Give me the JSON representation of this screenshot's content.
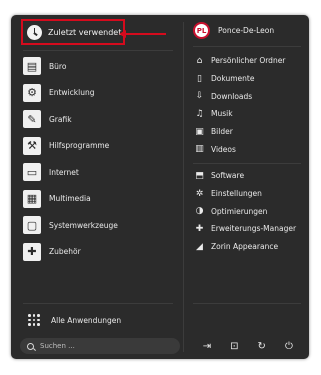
{
  "recent": {
    "label": "Zuletzt verwendet",
    "icon": "clock-icon"
  },
  "categories": [
    {
      "label": "Büro",
      "icon": "document-icon",
      "glyph": "▤"
    },
    {
      "label": "Entwicklung",
      "icon": "gear-icon",
      "glyph": "⚙"
    },
    {
      "label": "Grafik",
      "icon": "pencil-icon",
      "glyph": "✎"
    },
    {
      "label": "Hilfsprogramme",
      "icon": "wrench-icon",
      "glyph": "⚒"
    },
    {
      "label": "Internet",
      "icon": "globe-window-icon",
      "glyph": "▭"
    },
    {
      "label": "Multimedia",
      "icon": "film-icon",
      "glyph": "▦"
    },
    {
      "label": "Systemwerkzeuge",
      "icon": "monitor-icon",
      "glyph": "▢"
    },
    {
      "label": "Zubehör",
      "icon": "puzzle-icon",
      "glyph": "✚"
    }
  ],
  "all_apps": {
    "label": "Alle Anwendungen",
    "icon": "grid-icon"
  },
  "search": {
    "placeholder": "Suchen ...",
    "value": ""
  },
  "user": {
    "name": "Ponce-De-Leon",
    "avatar_text": "PL"
  },
  "places": [
    {
      "label": "Persönlicher Ordner",
      "icon": "home-icon",
      "glyph": "⌂"
    },
    {
      "label": "Dokumente",
      "icon": "document-outline-icon",
      "glyph": "▯"
    },
    {
      "label": "Downloads",
      "icon": "download-icon",
      "glyph": "⇩"
    },
    {
      "label": "Musik",
      "icon": "music-icon",
      "glyph": "♫"
    },
    {
      "label": "Bilder",
      "icon": "image-icon",
      "glyph": "▣"
    },
    {
      "label": "Videos",
      "icon": "video-icon",
      "glyph": "▥"
    }
  ],
  "system": [
    {
      "label": "Software",
      "icon": "software-icon",
      "glyph": "⬒"
    },
    {
      "label": "Einstellungen",
      "icon": "settings-icon",
      "glyph": "✲"
    },
    {
      "label": "Optimierungen",
      "icon": "toggle-icon",
      "glyph": "◑"
    },
    {
      "label": "Erweiterungs-Manager",
      "icon": "puzzle-small-icon",
      "glyph": "✚"
    },
    {
      "label": "Zorin Appearance",
      "icon": "appearance-icon",
      "glyph": "◢"
    }
  ],
  "footer": [
    {
      "name": "logout-icon",
      "glyph": "⇥"
    },
    {
      "name": "lock-icon",
      "glyph": "⊡"
    },
    {
      "name": "restart-icon",
      "glyph": "↻"
    },
    {
      "name": "power-icon",
      "glyph": "⏻"
    }
  ],
  "colors": {
    "menu_bg": "#2b2b2b",
    "highlight": "#d50b1d",
    "text": "#eaeaea"
  }
}
